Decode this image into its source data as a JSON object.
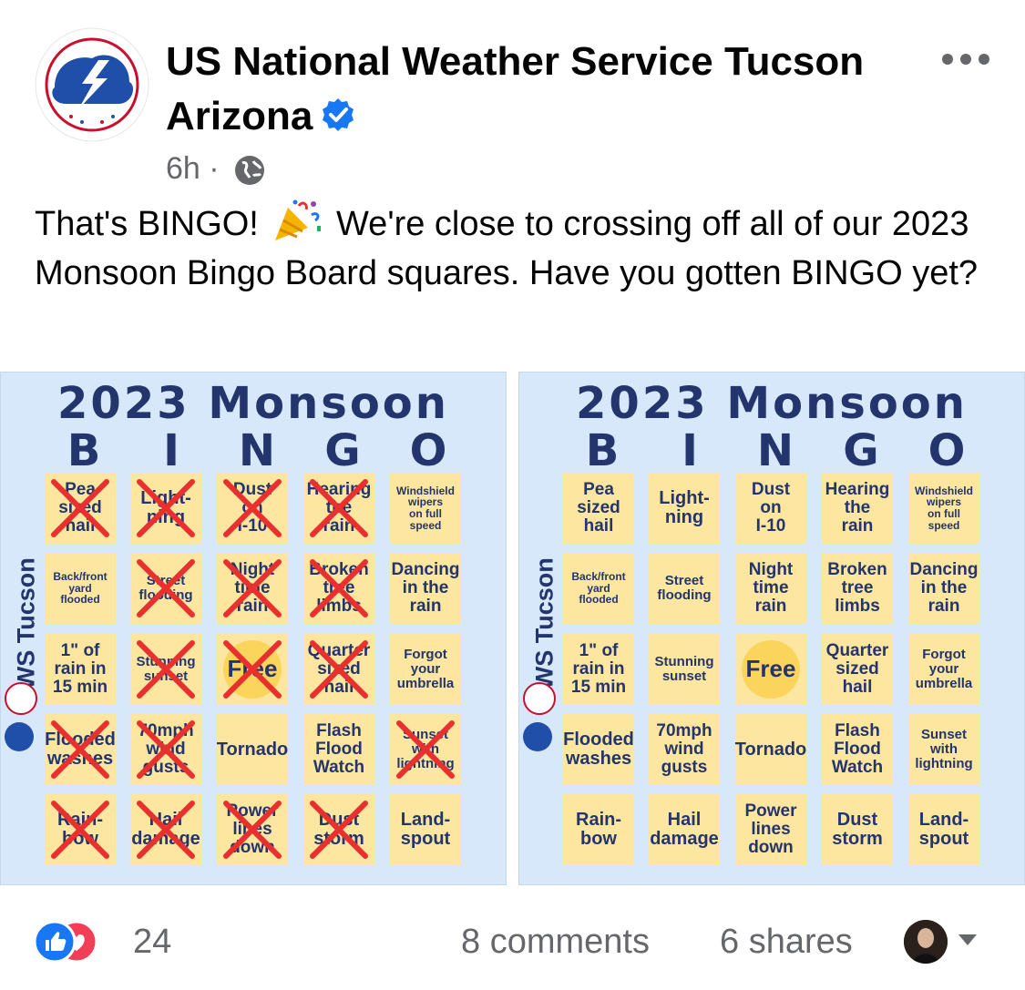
{
  "post": {
    "page_name": "US National Weather Service Tucson Arizona",
    "time": "6h",
    "separator": "·",
    "text_before": "That's BINGO!",
    "text_after": "We're close to crossing off all of our 2023 Monsoon Bingo Board squares. Have you gotten BINGO yet?",
    "icons": [
      "nws-logo-icon",
      "verified-badge-icon",
      "more-options-icon",
      "globe-icon",
      "party-popper-icon"
    ]
  },
  "boards": [
    {
      "title": "2023 Monsoon",
      "letters": [
        "B",
        "I",
        "N",
        "G",
        "O"
      ],
      "side_label": "NWS Tucson",
      "cells": [
        {
          "text": "Pea\nsized\nhail",
          "crossed": true
        },
        {
          "text": "Light-\nning",
          "crossed": true
        },
        {
          "text": "Dust\non\nI-10",
          "crossed": true
        },
        {
          "text": "Hearing\nthe\nrain",
          "crossed": true
        },
        {
          "text": "Windshield\nwipers\non full\nspeed",
          "crossed": false
        },
        {
          "text": "Back/front\nyard\nflooded",
          "crossed": false
        },
        {
          "text": "Street\nflooding",
          "crossed": true
        },
        {
          "text": "Night\ntime\nrain",
          "crossed": true
        },
        {
          "text": "Broken\ntree\nlimbs",
          "crossed": true
        },
        {
          "text": "Dancing\nin the\nrain",
          "crossed": false
        },
        {
          "text": "1\" of\nrain in\n15 min",
          "crossed": false
        },
        {
          "text": "Stunning\nsunset",
          "crossed": true
        },
        {
          "text": "Free",
          "crossed": true,
          "free": true
        },
        {
          "text": "Quarter\nsized\nhail",
          "crossed": true
        },
        {
          "text": "Forgot\nyour\numbrella",
          "crossed": false
        },
        {
          "text": "Flooded\nwashes",
          "crossed": true
        },
        {
          "text": "70mph\nwind\ngusts",
          "crossed": true
        },
        {
          "text": "Tornado",
          "crossed": false
        },
        {
          "text": "Flash\nFlood\nWatch",
          "crossed": false
        },
        {
          "text": "Sunset\nwith\nlightning",
          "crossed": true
        },
        {
          "text": "Rain-\nbow",
          "crossed": true
        },
        {
          "text": "Hail\ndamage",
          "crossed": true
        },
        {
          "text": "Power\nlines\ndown",
          "crossed": true
        },
        {
          "text": "Dust\nstorm",
          "crossed": true
        },
        {
          "text": "Land-\nspout",
          "crossed": false
        }
      ]
    },
    {
      "title": "2023 Monsoon",
      "letters": [
        "B",
        "I",
        "N",
        "G",
        "O"
      ],
      "side_label": "NWS Tucson",
      "cells": [
        {
          "text": "Pea\nsized\nhail",
          "crossed": false
        },
        {
          "text": "Light-\nning",
          "crossed": false
        },
        {
          "text": "Dust\non\nI-10",
          "crossed": false
        },
        {
          "text": "Hearing\nthe\nrain",
          "crossed": false
        },
        {
          "text": "Windshield\nwipers\non full\nspeed",
          "crossed": false
        },
        {
          "text": "Back/front\nyard\nflooded",
          "crossed": false
        },
        {
          "text": "Street\nflooding",
          "crossed": false
        },
        {
          "text": "Night\ntime\nrain",
          "crossed": false
        },
        {
          "text": "Broken\ntree\nlimbs",
          "crossed": false
        },
        {
          "text": "Dancing\nin the\nrain",
          "crossed": false
        },
        {
          "text": "1\" of\nrain in\n15 min",
          "crossed": false
        },
        {
          "text": "Stunning\nsunset",
          "crossed": false
        },
        {
          "text": "Free",
          "crossed": false,
          "free": true
        },
        {
          "text": "Quarter\nsized\nhail",
          "crossed": false
        },
        {
          "text": "Forgot\nyour\numbrella",
          "crossed": false
        },
        {
          "text": "Flooded\nwashes",
          "crossed": false
        },
        {
          "text": "70mph\nwind\ngusts",
          "crossed": false
        },
        {
          "text": "Tornado",
          "crossed": false
        },
        {
          "text": "Flash\nFlood\nWatch",
          "crossed": false
        },
        {
          "text": "Sunset\nwith\nlightning",
          "crossed": false
        },
        {
          "text": "Rain-\nbow",
          "crossed": false
        },
        {
          "text": "Hail\ndamage",
          "crossed": false
        },
        {
          "text": "Power\nlines\ndown",
          "crossed": false
        },
        {
          "text": "Dust\nstorm",
          "crossed": false
        },
        {
          "text": "Land-\nspout",
          "crossed": false
        }
      ]
    }
  ],
  "footer": {
    "reaction_count": "24",
    "comments": "8 comments",
    "shares": "6 shares",
    "icons": [
      "like-reaction-icon",
      "love-reaction-icon",
      "viewer-avatar",
      "dropdown-caret-icon"
    ]
  },
  "colors": {
    "board_bg": "#d6e8f9",
    "cell_bg": "#fde6a0",
    "title_navy": "#23356c",
    "cross_red": "#e8312f",
    "link_blue": "#1877f2",
    "love_red": "#f33e58",
    "meta_gray": "#65676b"
  }
}
